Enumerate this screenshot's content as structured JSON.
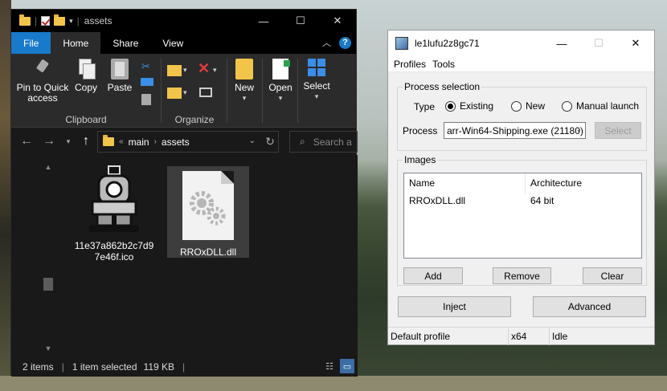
{
  "explorer": {
    "title": "assets",
    "window_controls": {
      "minimize": "—",
      "maximize": "☐",
      "close": "✕"
    },
    "tabs": [
      "File",
      "Home",
      "Share",
      "View"
    ],
    "ribbon": {
      "pin_label_line1": "Pin to Quick",
      "pin_label_line2": "access",
      "copy_label": "Copy",
      "paste_label": "Paste",
      "clipboard_group": "Clipboard",
      "organize_group": "Organize",
      "new_label": "New",
      "open_label": "Open",
      "select_label": "Select"
    },
    "address": {
      "overflow": "«",
      "crumbs": [
        "main",
        "assets"
      ]
    },
    "search_placeholder": "Search a",
    "files": [
      {
        "name_line1": "11e37a862b2c7d9",
        "name_line2": "7e46f.ico"
      },
      {
        "name_line1": "RROxDLL.dll"
      }
    ],
    "status": {
      "items": "2 items",
      "selected": "1 item selected",
      "size": "119 KB"
    }
  },
  "injector": {
    "title": "le1lufu2z8gc71",
    "window_controls": {
      "minimize": "—",
      "maximize": "☐",
      "close": "✕"
    },
    "menu": [
      "Profiles",
      "Tools"
    ],
    "process_selection": {
      "legend": "Process selection",
      "type_label": "Type",
      "options": [
        "Existing",
        "New",
        "Manual launch"
      ],
      "selected_option": "Existing",
      "process_label": "Process",
      "process_value": "arr-Win64-Shipping.exe (21180)",
      "select_button": "Select"
    },
    "images": {
      "legend": "Images",
      "columns": [
        "Name",
        "Architecture"
      ],
      "rows": [
        {
          "name": "RROxDLL.dll",
          "arch": "64 bit"
        }
      ],
      "add_button": "Add",
      "remove_button": "Remove",
      "clear_button": "Clear"
    },
    "inject_button": "Inject",
    "advanced_button": "Advanced",
    "status": {
      "profile": "Default profile",
      "arch": "x64",
      "state": "Idle"
    }
  }
}
